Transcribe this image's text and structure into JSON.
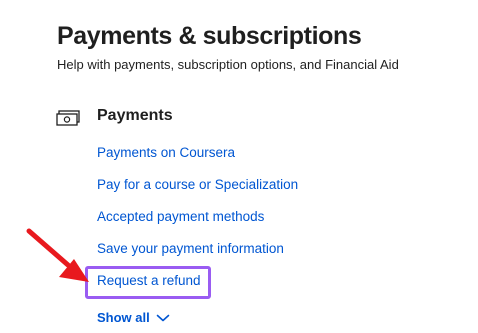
{
  "header": {
    "title": "Payments & subscriptions",
    "subtitle": "Help with payments, subscription options, and Financial Aid"
  },
  "section": {
    "title": "Payments",
    "icon": "cash-icon",
    "links": [
      {
        "label": "Payments on Coursera"
      },
      {
        "label": "Pay for a course or Specialization"
      },
      {
        "label": "Accepted payment methods"
      },
      {
        "label": "Save your payment information"
      },
      {
        "label": "Request a refund"
      }
    ],
    "show_all_label": "Show all",
    "show_all_icon": "chevron-down-icon"
  },
  "annotation": {
    "arrow_color": "#e8191e",
    "highlight_color": "#9a5cf2",
    "highlighted_link": "Request a refund"
  },
  "colors": {
    "link": "#0056d2",
    "text": "#1f1f1f"
  }
}
